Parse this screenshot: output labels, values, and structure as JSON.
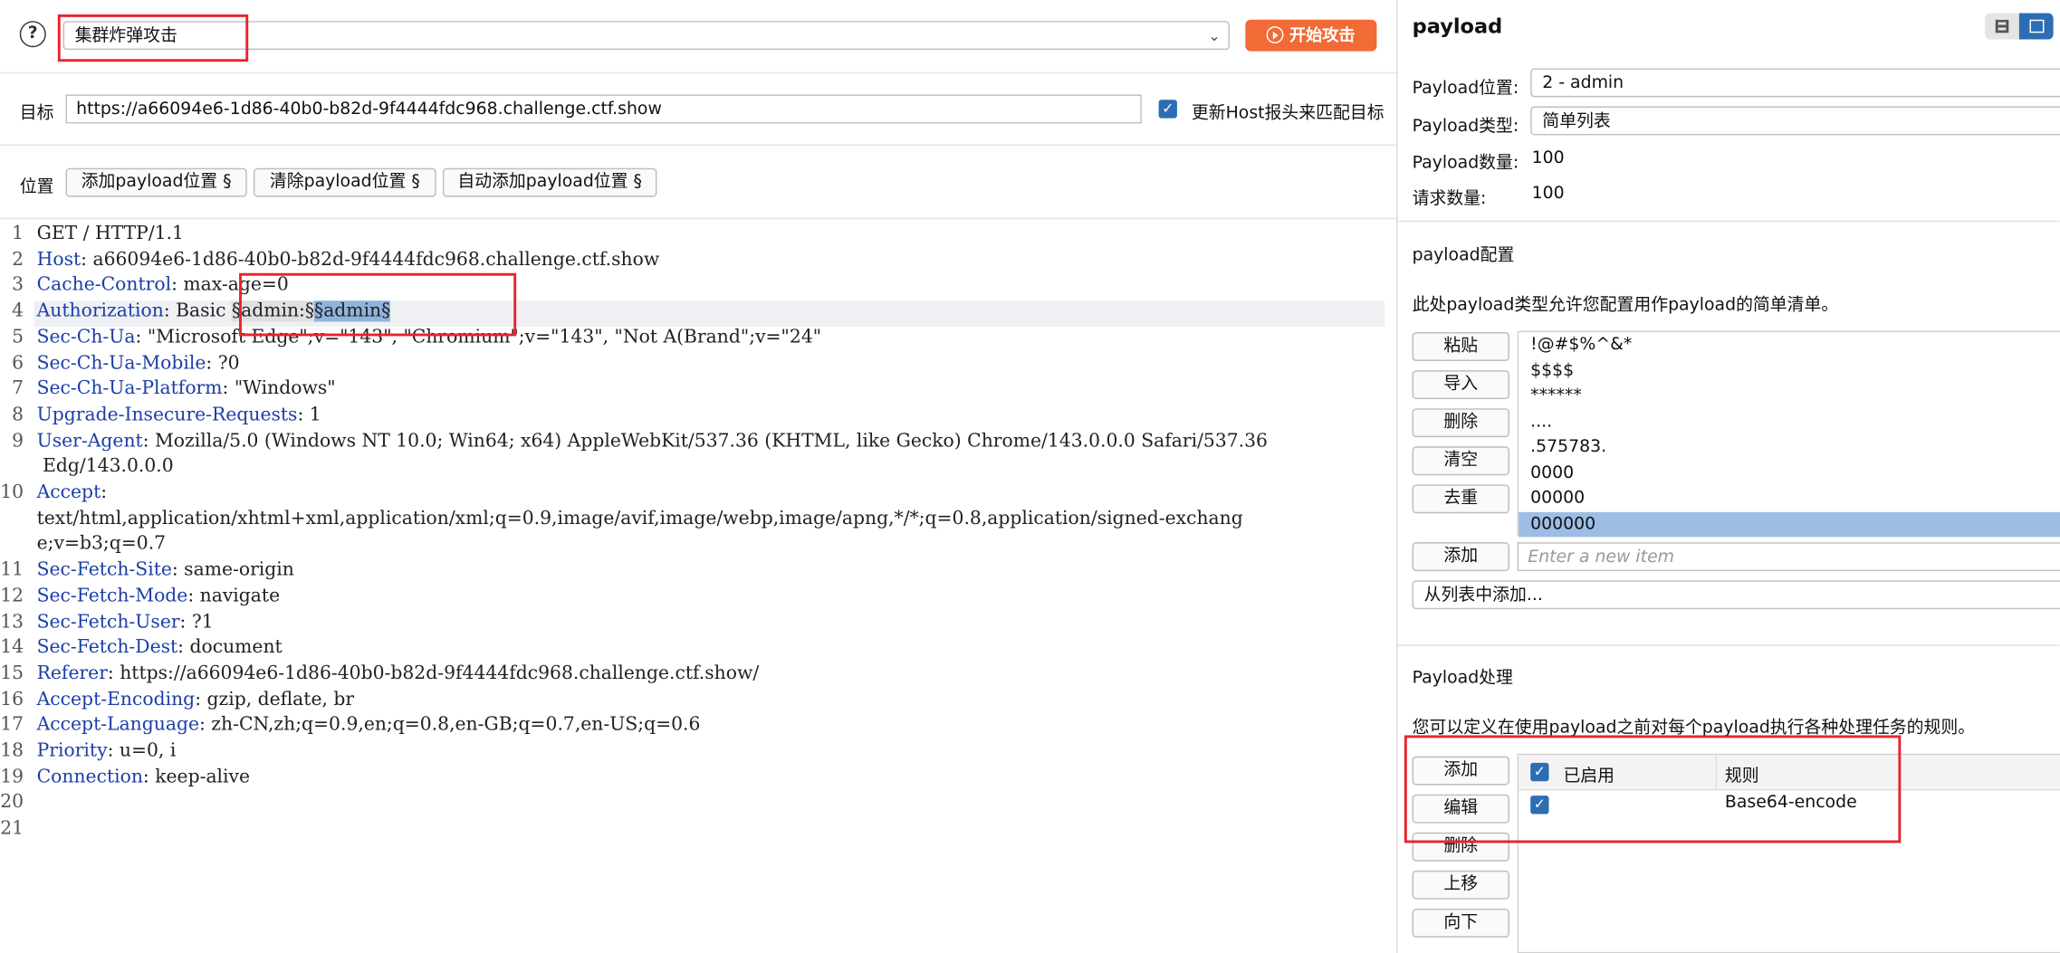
{
  "header": {
    "help_icon": "question-circle-icon",
    "attack_type": "集群炸弹攻击",
    "start_attack_label": "开始攻击"
  },
  "target": {
    "label": "目标",
    "url": "https://a66094e6-1d86-40b0-b82d-9f4444fdc968.challenge.ctf.show",
    "update_host_label": "更新Host报头来匹配目标",
    "update_host_checked": true
  },
  "positions": {
    "label": "位置",
    "add_label": "添加payload位置 §",
    "clear_label": "清除payload位置 §",
    "auto_label": "自动添加payload位置 §"
  },
  "request_lines": [
    {
      "n": "1",
      "parts": [
        {
          "t": "GET / HTTP/1.1"
        }
      ]
    },
    {
      "n": "2",
      "parts": [
        {
          "t": "Host",
          "k": 1
        },
        {
          "t": ": a66094e6-1d86-40b0-b82d-9f4444fdc968.challenge.ctf.show"
        }
      ]
    },
    {
      "n": "3",
      "parts": [
        {
          "t": "Cache-Control",
          "k": 1
        },
        {
          "t": ": max-age=0"
        }
      ]
    },
    {
      "n": "4",
      "parts": [
        {
          "t": "Authorization",
          "k": 1
        },
        {
          "t": ": Basic "
        },
        {
          "t": "§admin:§",
          "p": 1
        },
        {
          "t": "§admin§",
          "p": 2
        }
      ],
      "hl": true
    },
    {
      "n": "5",
      "parts": [
        {
          "t": "Sec-Ch-Ua",
          "k": 1
        },
        {
          "t": ": \"Microsoft Edge\";v=\"143\", \"Chromium\";v=\"143\", \"Not A(Brand\";v=\"24\""
        }
      ]
    },
    {
      "n": "6",
      "parts": [
        {
          "t": "Sec-Ch-Ua-Mobile",
          "k": 1
        },
        {
          "t": ": ?0"
        }
      ]
    },
    {
      "n": "7",
      "parts": [
        {
          "t": "Sec-Ch-Ua-Platform",
          "k": 1
        },
        {
          "t": ": \"Windows\""
        }
      ]
    },
    {
      "n": "8",
      "parts": [
        {
          "t": "Upgrade-Insecure-Requests",
          "k": 1
        },
        {
          "t": ": 1"
        }
      ]
    },
    {
      "n": "9",
      "parts": [
        {
          "t": "User-Agent",
          "k": 1
        },
        {
          "t": ": Mozilla/5.0 (Windows NT 10.0; Win64; x64) AppleWebKit/537.36 (KHTML, like Gecko) Chrome/143.0.0.0 Safari/537.36"
        }
      ]
    },
    {
      "n": "",
      "parts": [
        {
          "t": " Edg/143.0.0.0"
        }
      ]
    },
    {
      "n": "10",
      "parts": [
        {
          "t": "Accept",
          "k": 1
        },
        {
          "t": ":"
        }
      ]
    },
    {
      "n": "",
      "parts": [
        {
          "t": "text/html,application/xhtml+xml,application/xml;q=0.9,image/avif,image/webp,image/apng,*/*;q=0.8,application/signed-exchang"
        }
      ]
    },
    {
      "n": "",
      "parts": [
        {
          "t": "e;v=b3;q=0.7"
        }
      ]
    },
    {
      "n": "11",
      "parts": [
        {
          "t": "Sec-Fetch-Site",
          "k": 1
        },
        {
          "t": ": same-origin"
        }
      ]
    },
    {
      "n": "12",
      "parts": [
        {
          "t": "Sec-Fetch-Mode",
          "k": 1
        },
        {
          "t": ": navigate"
        }
      ]
    },
    {
      "n": "13",
      "parts": [
        {
          "t": "Sec-Fetch-User",
          "k": 1
        },
        {
          "t": ": ?1"
        }
      ]
    },
    {
      "n": "14",
      "parts": [
        {
          "t": "Sec-Fetch-Dest",
          "k": 1
        },
        {
          "t": ": document"
        }
      ]
    },
    {
      "n": "15",
      "parts": [
        {
          "t": "Referer",
          "k": 1
        },
        {
          "t": ": https://a66094e6-1d86-40b0-b82d-9f4444fdc968.challenge.ctf.show/"
        }
      ]
    },
    {
      "n": "16",
      "parts": [
        {
          "t": "Accept-Encoding",
          "k": 1
        },
        {
          "t": ": gzip, deflate, br"
        }
      ]
    },
    {
      "n": "17",
      "parts": [
        {
          "t": "Accept-Language",
          "k": 1
        },
        {
          "t": ": zh-CN,zh;q=0.9,en;q=0.8,en-GB;q=0.7,en-US;q=0.6"
        }
      ]
    },
    {
      "n": "18",
      "parts": [
        {
          "t": "Priority",
          "k": 1
        },
        {
          "t": ": u=0, i"
        }
      ]
    },
    {
      "n": "19",
      "parts": [
        {
          "t": "Connection",
          "k": 1
        },
        {
          "t": ": keep-alive"
        }
      ]
    },
    {
      "n": "20",
      "parts": []
    },
    {
      "n": "21",
      "parts": []
    }
  ],
  "payload_panel": {
    "title": "payload",
    "position_label": "Payload位置:",
    "position_value": "2 - admin",
    "type_label": "Payload类型:",
    "type_value": "简单列表",
    "count_label": "Payload数量:",
    "count_value": "100",
    "request_label": "请求数量:",
    "request_value": "100"
  },
  "payload_config": {
    "title": "payload配置",
    "description": "此处payload类型允许您配置用作payload的简单清单。",
    "buttons": [
      "粘贴",
      "导入",
      "删除",
      "清空",
      "去重"
    ],
    "items": [
      "!@#$%^&*",
      "$$$$",
      "******",
      "....",
      ".575783.",
      "0000",
      "00000",
      "000000"
    ],
    "selected_index": 7,
    "add_label": "添加",
    "new_item_placeholder": "Enter a new item",
    "from_list_label": "从列表中添加..."
  },
  "payload_processing": {
    "title": "Payload处理",
    "description": "您可以定义在使用payload之前对每个payload执行各种处理任务的规则。",
    "buttons": [
      "添加",
      "编辑",
      "删除",
      "上移",
      "向下"
    ],
    "col_enabled": "已启用",
    "col_rule": "规则",
    "rules": [
      {
        "enabled": true,
        "rule": "Base64-encode"
      }
    ]
  },
  "colors": {
    "accent": "#f26a35",
    "highlight_box": "#e8242b",
    "header_key": "#1c3ea8",
    "checkbox": "#2c6db4"
  }
}
